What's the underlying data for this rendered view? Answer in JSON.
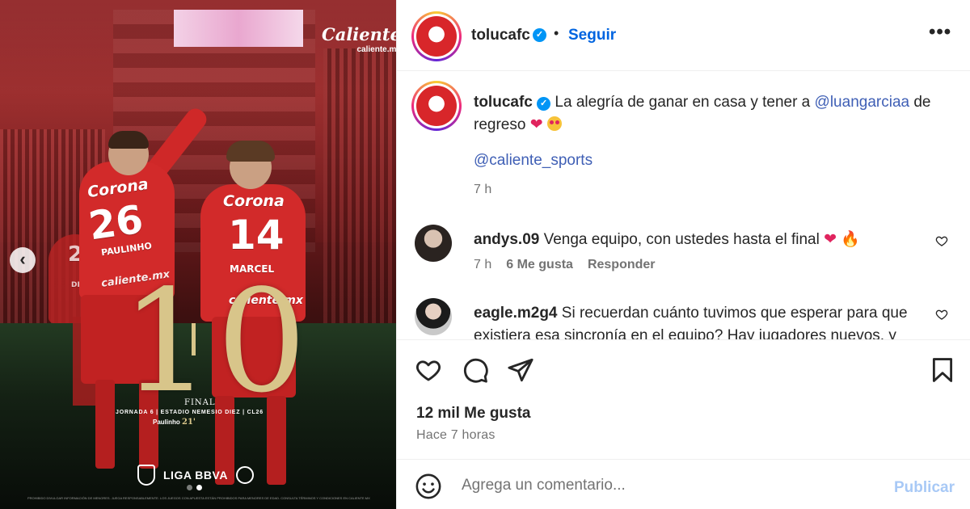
{
  "media": {
    "sponsor_brand": "Caliente",
    "sponsor_site": "caliente.mx",
    "jersey_sponsor": "Corona",
    "jersey_sponsor_small": "caliente.mx",
    "player_a_number": "26",
    "player_a_name": "PAULINHO",
    "player_b_number": "14",
    "player_b_name": "MARCEL",
    "player_c_number": "2",
    "player_c_name": "DIAZ PR",
    "score_home": "1",
    "score_away": "0",
    "match_status": "FINAL",
    "match_info": "JORNADA 6 | ESTADIO NEMESIO DIEZ | CL26",
    "scorer_name": "Paulinho",
    "scorer_minute": "21'",
    "league_name": "LIGA BBVA",
    "disclaimer": "PROHIBIDO DIVULGAR INFORMACIÓN DE MENORES. JUEGA RESPONSABLEMENTE. LOS JUEGOS CON APUESTA ESTÁN PROHIBIDOS PARA MENORES DE EDAD. CONSULTA TÉRMINOS Y CONDICIONES EN CALIENTE.MX",
    "prev_icon": "chevron-left-icon",
    "slide_count": 2,
    "active_slide": 2
  },
  "header": {
    "username": "tolucafc",
    "separator": "•",
    "follow_label": "Seguir",
    "more_label": "•••"
  },
  "caption": {
    "username": "tolucafc",
    "text_before": "La alegría de ganar en casa y tener a",
    "mention": "@luangarciaa",
    "text_after": "de regreso",
    "sponsor_mention": "@caliente_sports",
    "time": "7 h"
  },
  "comments": [
    {
      "username": "andys.09",
      "text": "Venga equipo, con ustedes hasta el final",
      "time": "7 h",
      "likes": "6 Me gusta",
      "reply_label": "Responder"
    },
    {
      "username": "eagle.m2g4",
      "text": "Si recuerdan cuánto tuvimos que esperar para que existiera esa sincronía en el equipo? Hay jugadores nuevos, y",
      "time": "",
      "likes": "",
      "reply_label": ""
    }
  ],
  "actions": {
    "like_icon": "heart-icon",
    "comment_icon": "comment-bubble-icon",
    "share_icon": "paper-plane-icon",
    "save_icon": "bookmark-icon",
    "likes_count": "12 mil Me gusta",
    "posted_time": "Hace 7 horas"
  },
  "composer": {
    "emoji_icon": "smiley-icon",
    "placeholder": "Agrega un comentario...",
    "publish_label": "Publicar"
  },
  "colors": {
    "link": "#0064e0",
    "mention": "#3f5fb5",
    "publish_disabled": "#a8c9f6",
    "club_red": "#d8262a",
    "score_gold": "#d8c58a"
  }
}
